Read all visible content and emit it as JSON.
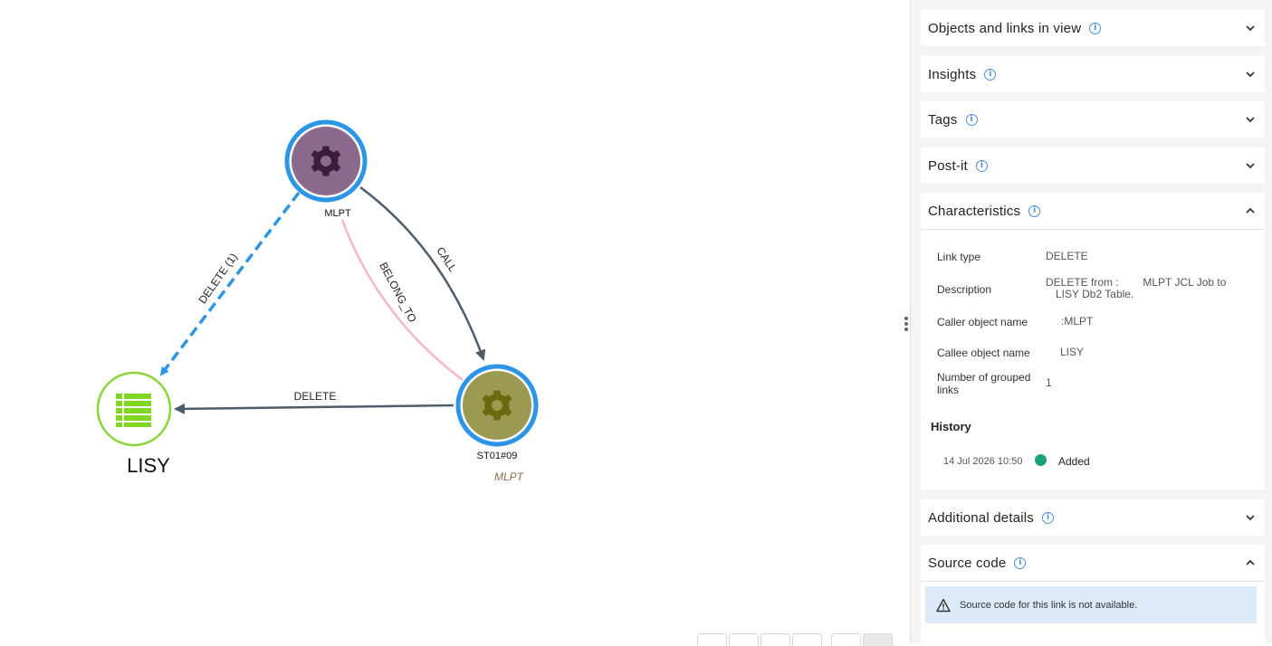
{
  "graph": {
    "nodes": {
      "mlpt": {
        "label": "MLPT",
        "fill": "#8b6a8d",
        "ring": "#2d95e6",
        "gear_color": "#3e1b3f"
      },
      "st01": {
        "label": "ST01#09",
        "sublabel": "MLPT",
        "fill": "#9a9a52",
        "ring": "#2d95e6",
        "gear_color": "#6a6a10"
      },
      "lisy": {
        "label": "LISY",
        "ring": "#8ad43a",
        "icon_color": "#7fd61e"
      }
    },
    "edges": {
      "delete_grouped": {
        "label": "DELETE (1)",
        "color": "#2d95e6"
      },
      "call": {
        "label": "CALL",
        "color": "#4e5d6c"
      },
      "belong_to": {
        "label": "BELONG_TO",
        "color": "#f4b6c8"
      },
      "delete": {
        "label": "DELETE",
        "color": "#4e5d6c"
      }
    }
  },
  "sidebar": {
    "panels": {
      "objects_links": {
        "title": "Objects and links in view",
        "icon": "chevron-down-icon"
      },
      "insights": {
        "title": "Insights",
        "icon": "chevron-down-icon"
      },
      "tags": {
        "title": "Tags",
        "icon": "chevron-down-icon"
      },
      "postit": {
        "title": "Post-it",
        "icon": "chevron-down-icon"
      },
      "characteristics": {
        "title": "Characteristics",
        "icon": "chevron-up-icon"
      },
      "additional": {
        "title": "Additional details",
        "icon": "chevron-down-icon"
      },
      "source": {
        "title": "Source code",
        "icon": "chevron-up-icon"
      }
    },
    "characteristics": {
      "link_type": {
        "key": "Link type",
        "value": "DELETE"
      },
      "description": {
        "key": "Description",
        "value_line1": "DELETE from :        MLPT JCL Job to",
        "value_line2": "LISY Db2 Table."
      },
      "caller": {
        "key": "Caller object name",
        "value": ":MLPT"
      },
      "callee": {
        "key": "Callee object name",
        "value": "LISY"
      },
      "grouped": {
        "key_line1": "Number of grouped",
        "key_line2": "links",
        "value": "1"
      }
    },
    "history": {
      "title": "History",
      "entries": [
        {
          "date": "14 Jul 2026 10:50",
          "status": "Added",
          "dot_color": "#1aa37a"
        }
      ]
    },
    "source_notice": "Source code for this link is not available."
  }
}
